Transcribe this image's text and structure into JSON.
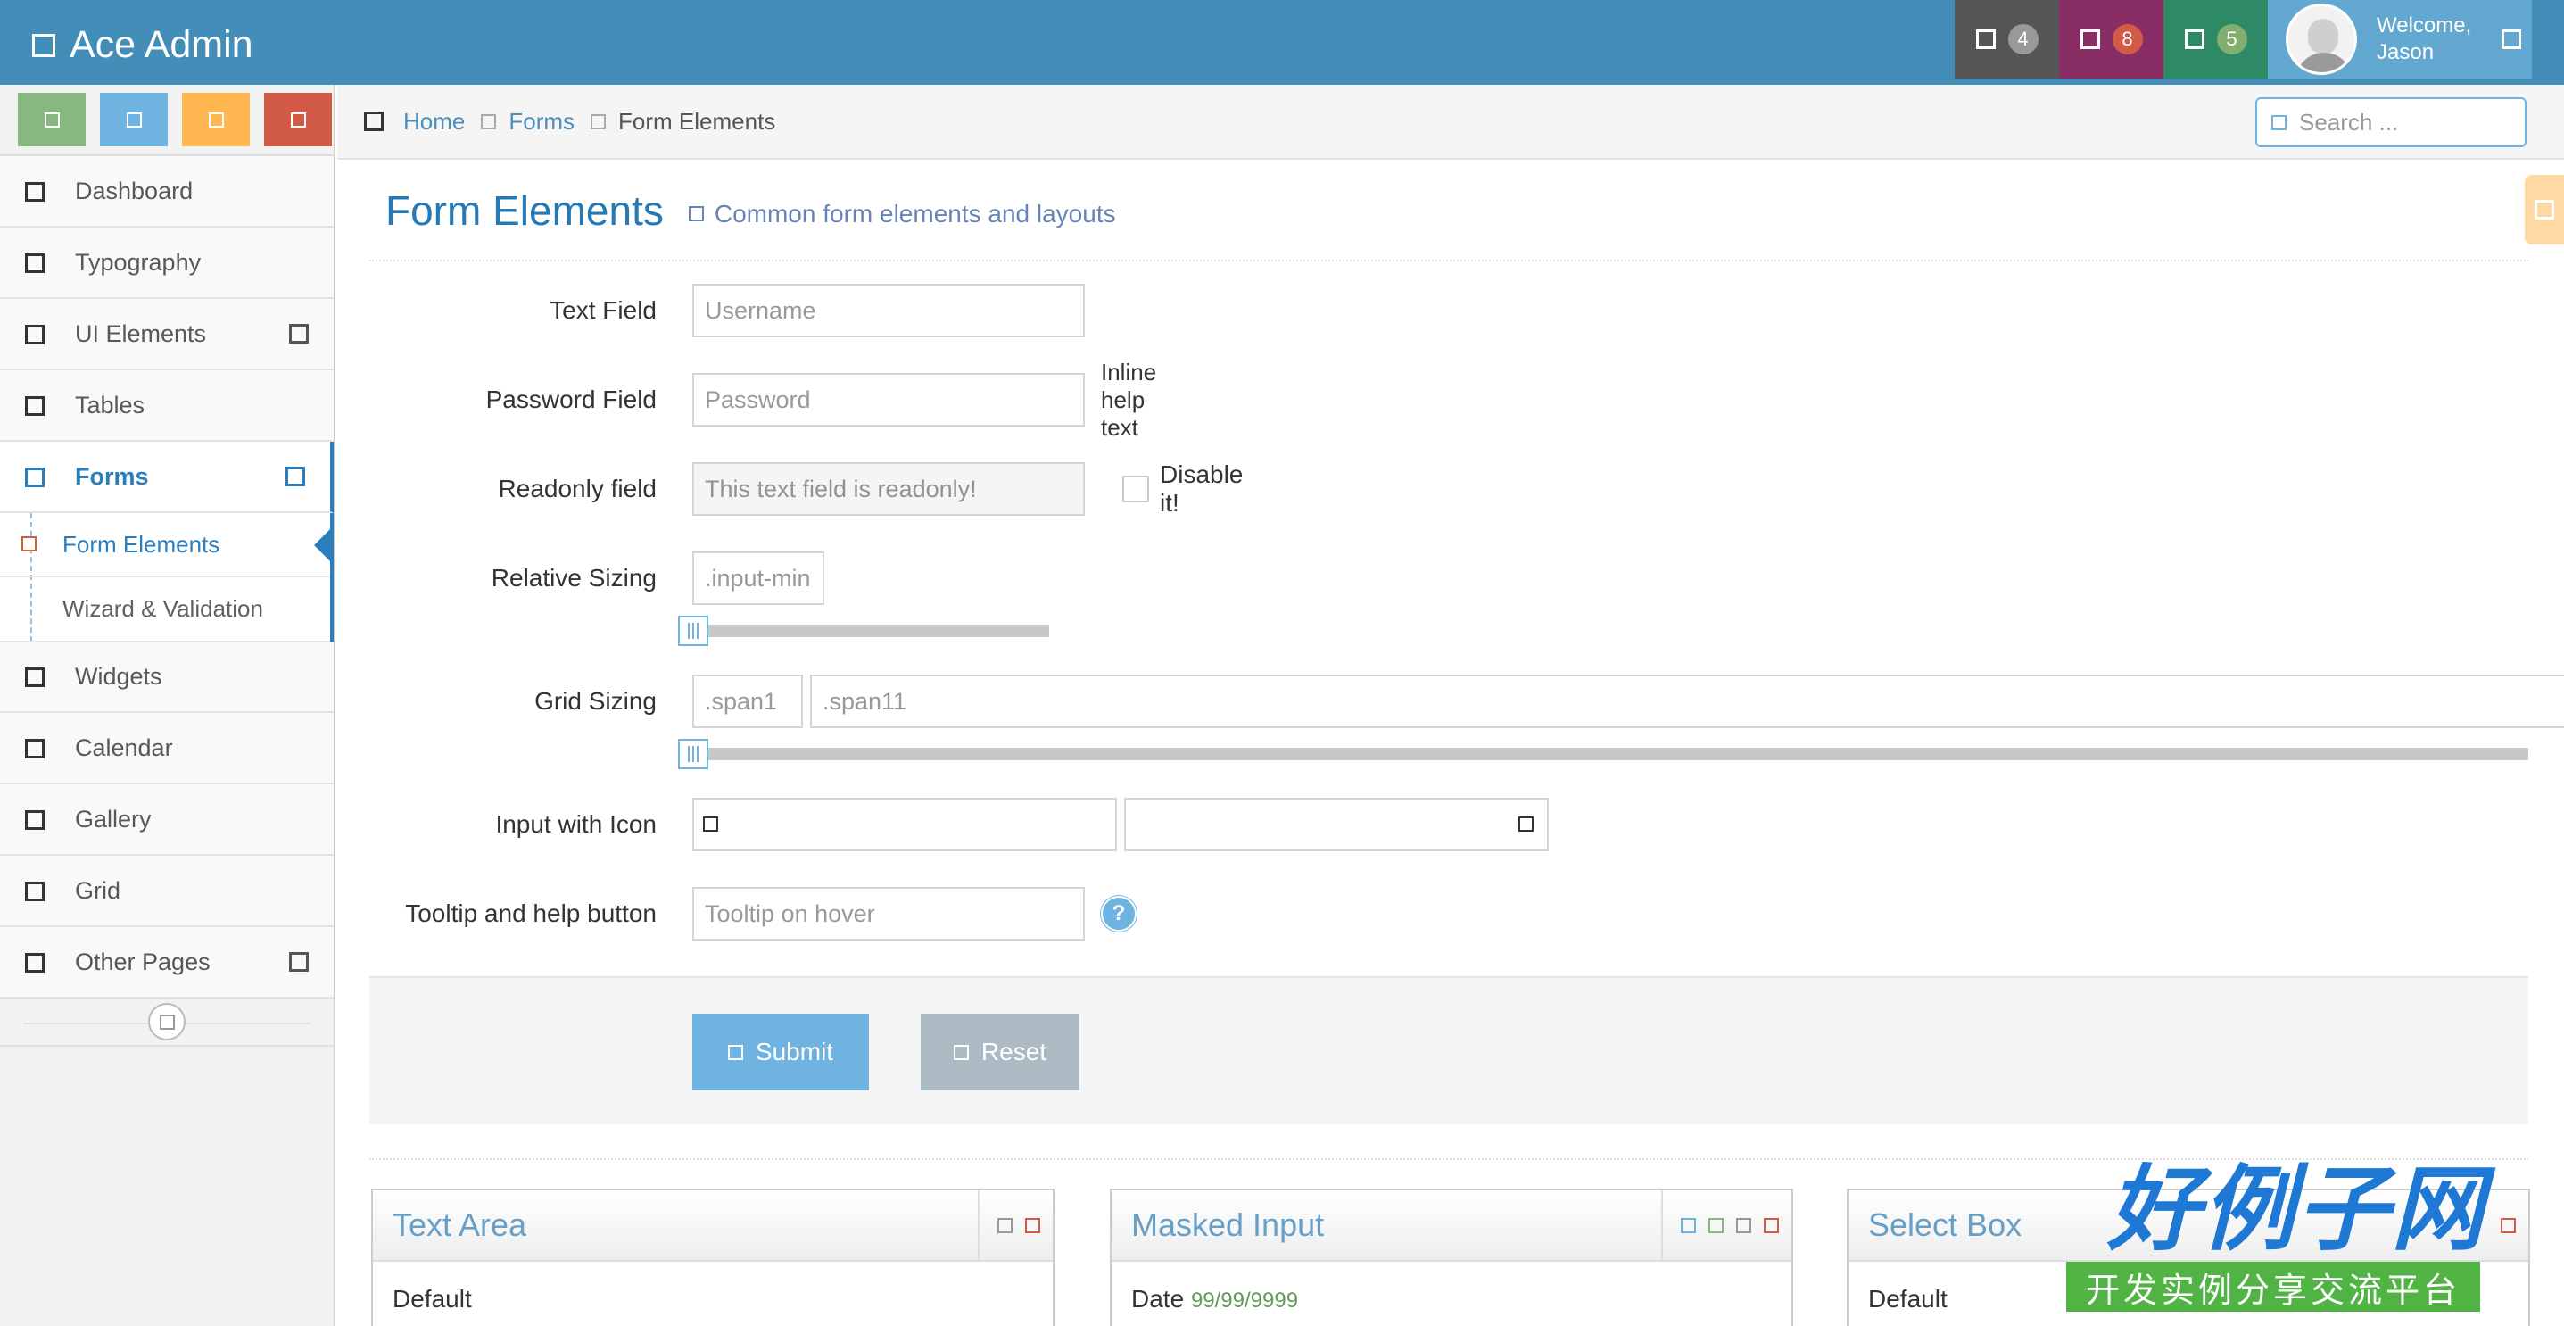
{
  "app": {
    "title": "Ace Admin"
  },
  "navbar": {
    "tasks_badge": "4",
    "notifications_badge": "8",
    "messages_badge": "5",
    "welcome": "Welcome,",
    "user_name": "Jason"
  },
  "sidebar": {
    "items": [
      {
        "label": "Dashboard"
      },
      {
        "label": "Typography"
      },
      {
        "label": "UI Elements"
      },
      {
        "label": "Tables"
      },
      {
        "label": "Forms"
      },
      {
        "label": "Widgets"
      },
      {
        "label": "Calendar"
      },
      {
        "label": "Gallery"
      },
      {
        "label": "Grid"
      },
      {
        "label": "Other Pages"
      }
    ],
    "forms_submenu": [
      {
        "label": "Form Elements"
      },
      {
        "label": "Wizard & Validation"
      }
    ]
  },
  "breadcrumb": {
    "home": "Home",
    "forms": "Forms",
    "current": "Form Elements"
  },
  "search": {
    "placeholder": "Search ..."
  },
  "page": {
    "title": "Form Elements",
    "subtitle": "Common form elements and layouts"
  },
  "form": {
    "text_field": {
      "label": "Text Field",
      "placeholder": "Username"
    },
    "password_field": {
      "label": "Password Field",
      "placeholder": "Password",
      "help": "Inline help text"
    },
    "readonly_field": {
      "label": "Readonly field",
      "value": "This text field is readonly!",
      "checkbox_label": "Disable it!"
    },
    "relative_sizing": {
      "label": "Relative Sizing",
      "placeholder": ".input-mini"
    },
    "grid_sizing": {
      "label": "Grid Sizing",
      "placeholder_1": ".span1",
      "placeholder_2": ".span11"
    },
    "input_with_icon": {
      "label": "Input with Icon"
    },
    "tooltip": {
      "label": "Tooltip and help button",
      "placeholder": "Tooltip on hover",
      "help_symbol": "?"
    },
    "submit_label": "Submit",
    "reset_label": "Reset"
  },
  "widgets": [
    {
      "title": "Text Area",
      "body": "Default"
    },
    {
      "title": "Masked Input",
      "body": "Date",
      "sample": "99/99/9999"
    },
    {
      "title": "Select Box",
      "body": "Default"
    }
  ],
  "watermark": {
    "line1": "好例子网",
    "line2": "开发实例分享交流平台"
  },
  "colors": {
    "navbar": "#438eb9",
    "accent": "#2679b5",
    "submit": "#6fb3e0",
    "reset": "#abbac3"
  }
}
